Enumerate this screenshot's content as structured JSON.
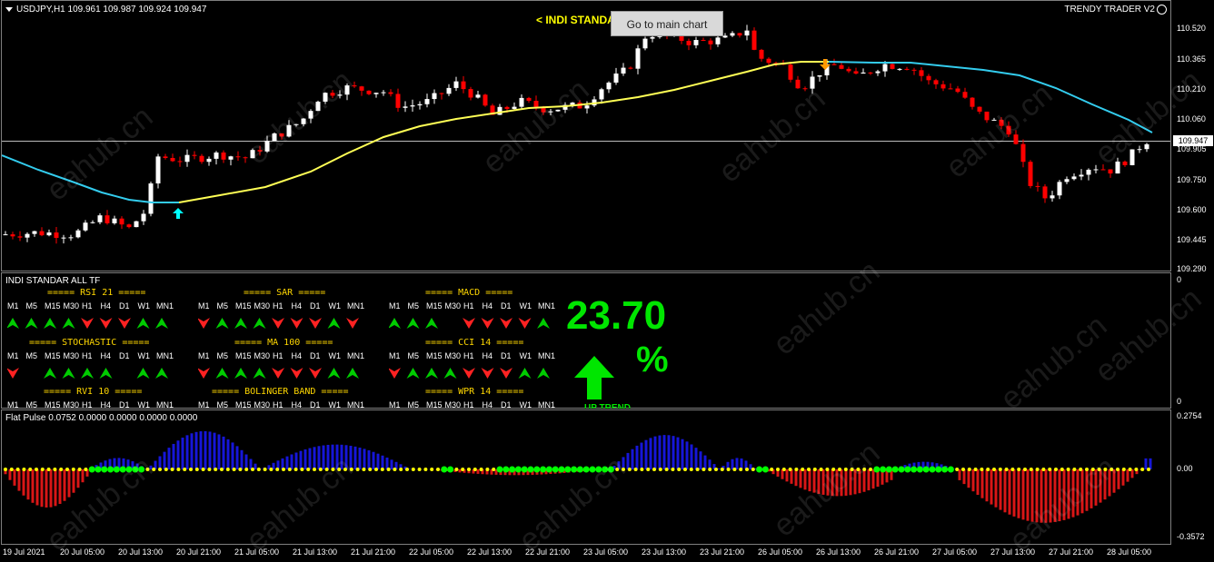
{
  "main": {
    "symbol_info": "USDJPY,H1  109.961 109.987 109.924 109.947",
    "indicator_title": "< INDI STANDAR ALL TF >",
    "tooltip": "Go to main chart",
    "brand": "TRENDY TRADER V2",
    "current_price": "109.947",
    "price_ticks": [
      "110.520",
      "110.365",
      "110.210",
      "110.060",
      "109.905",
      "109.750",
      "109.600",
      "109.445",
      "109.290"
    ]
  },
  "indi_panel": {
    "name": "INDI STANDAR ALL TF",
    "scale_top": "0",
    "scale_bottom": "0",
    "timeframes": [
      "M1",
      "M5",
      "M15",
      "M30",
      "H1",
      "H4",
      "D1",
      "W1",
      "MN1"
    ],
    "groups": [
      {
        "title": "===== RSI 21 =====",
        "arrows": [
          "up",
          "up",
          "up",
          "up",
          "down",
          "down",
          "down",
          "up",
          "up"
        ]
      },
      {
        "title": "===== SAR =====",
        "arrows": [
          "down",
          "up",
          "up",
          "up",
          "down",
          "down",
          "down",
          "up",
          "down"
        ]
      },
      {
        "title": "===== MACD =====",
        "arrows": [
          "up",
          "up",
          "up",
          "",
          "down",
          "down",
          "down",
          "down",
          "up"
        ]
      },
      {
        "title": "===== STOCHASTIC =====",
        "arrows": [
          "down",
          "",
          "up",
          "up",
          "up",
          "up",
          "",
          "up",
          "up"
        ]
      },
      {
        "title": "===== MA 100 =====",
        "arrows": [
          "down",
          "up",
          "up",
          "up",
          "down",
          "down",
          "down",
          "up",
          "up"
        ]
      },
      {
        "title": "===== CCI 14 =====",
        "arrows": [
          "down",
          "up",
          "up",
          "up",
          "down",
          "down",
          "down",
          "up",
          "up"
        ]
      },
      {
        "title": "===== RVI 10 =====",
        "arrows": []
      },
      {
        "title": "===== BOLINGER BAND =====",
        "arrows": []
      },
      {
        "title": "===== WPR 14 =====",
        "arrows": []
      }
    ],
    "percentage": "23.70",
    "percent_sign": "%",
    "trend_label": "UP TREND"
  },
  "pulse_panel": {
    "name": "Flat Pulse 0.0752 0.0000 0.0000 0.0000 0.0000",
    "scale": [
      "0.2754",
      "0.00",
      "-0.3572"
    ]
  },
  "time_axis": [
    "19 Jul 2021",
    "20 Jul 05:00",
    "20 Jul 13:00",
    "20 Jul 21:00",
    "21 Jul 05:00",
    "21 Jul 13:00",
    "21 Jul 21:00",
    "22 Jul 05:00",
    "22 Jul 13:00",
    "22 Jul 21:00",
    "23 Jul 05:00",
    "23 Jul 13:00",
    "23 Jul 21:00",
    "26 Jul 05:00",
    "26 Jul 13:00",
    "26 Jul 21:00",
    "27 Jul 05:00",
    "27 Jul 13:00",
    "27 Jul 21:00",
    "28 Jul 05:00"
  ],
  "watermark": "eahub.cn",
  "colors": {
    "bull": "#ffffff",
    "bear": "#ff0000",
    "ma_fast": "#ffff55",
    "ma_slow": "#33ccee",
    "up_arrow": "#00cc00",
    "down_arrow": "#ff2222",
    "pulse_pos": "#1a1aff",
    "pulse_neg": "#ff1a1a",
    "flat_dot": "#ffff00",
    "active_dot": "#00ff00"
  }
}
